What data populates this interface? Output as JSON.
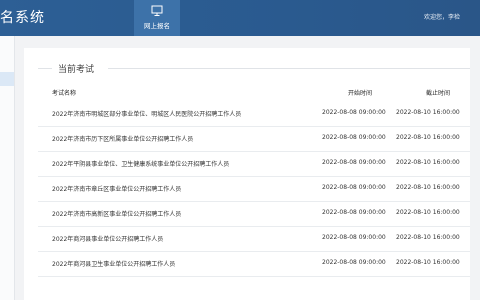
{
  "header": {
    "system_title": "名系统",
    "nav_tab_label": "网上报名",
    "user_greeting": "欢迎您，李检"
  },
  "section": {
    "title": "当前考试"
  },
  "table": {
    "columns": {
      "name": "考试名称",
      "start": "开始时间",
      "end": "截止时间"
    },
    "rows": [
      {
        "name": "2022年济南市明城区部分事业单位、明城区人民医院公开招聘工作人员",
        "start": "2022-08-08 09:00:00",
        "end": "2022-08-10 16:00:00"
      },
      {
        "name": "2022年济南市历下区所属事业单位公开招聘工作人员",
        "start": "2022-08-08 09:00:00",
        "end": "2022-08-10 16:00:00"
      },
      {
        "name": "2022年平阴县事业单位、卫生健康系统事业单位公开招聘工作人员",
        "start": "2022-08-08 09:00:00",
        "end": "2022-08-10 16:00:00"
      },
      {
        "name": "2022年济南市章丘区事业单位公开招聘工作人员",
        "start": "2022-08-08 09:00:00",
        "end": "2022-08-10 16:00:00"
      },
      {
        "name": "2022年济南市高新区事业单位公开招聘工作人员",
        "start": "2022-08-08 09:00:00",
        "end": "2022-08-10 16:00:00"
      },
      {
        "name": "2022年商河县事业单位公开招聘工作人员",
        "start": "2022-08-08 09:00:00",
        "end": "2022-08-10 16:00:00"
      },
      {
        "name": "2022年商河县卫生事业单位公开招聘工作人员",
        "start": "2022-08-08 09:00:00",
        "end": "2022-08-10 16:00:00"
      }
    ]
  },
  "colors": {
    "header_bg": "#2d5f95",
    "nav_tab_bg": "#3d72a9",
    "page_bg": "#f2f3f5"
  },
  "icons": {
    "nav_tab": "monitor-icon"
  }
}
